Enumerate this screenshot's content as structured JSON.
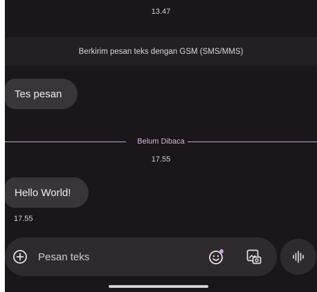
{
  "conversation": {
    "top_timestamp": "13.47",
    "sms_banner": "Berkirim pesan teks dengan GSM (SMS/MMS)",
    "messages": [
      {
        "text": "Tes pesan",
        "timestamp": ""
      },
      {
        "text": "Hello World!",
        "timestamp": "17.55"
      }
    ],
    "unread_label": "Belum Dibaca",
    "unread_timestamp": "17.55"
  },
  "compose": {
    "placeholder": "Pesan teks"
  },
  "icons": {
    "add": "add-circle-icon",
    "emoji": "emoji-icon",
    "gallery": "gallery-icon",
    "voice": "voice-waveform-icon"
  },
  "colors": {
    "background": "#1a1619",
    "bubble": "#3a3538",
    "accent": "#c8a8d8"
  }
}
